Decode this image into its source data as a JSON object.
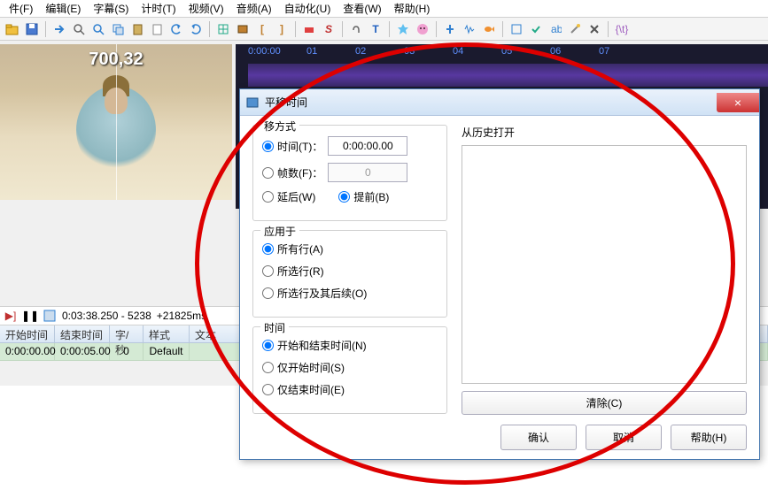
{
  "menu": [
    "件(F)",
    "编辑(E)",
    "字幕(S)",
    "计时(T)",
    "视频(V)",
    "音频(A)",
    "自动化(U)",
    "查看(W)",
    "帮助(H)"
  ],
  "video": {
    "timestamp": "700,32"
  },
  "ruler": [
    "0:00:00",
    "01",
    "02",
    "03",
    "04",
    "05",
    "06",
    "07"
  ],
  "playback": {
    "time": "0:03:38.250 - 5238",
    "offset": "+21825ms"
  },
  "grid": {
    "headers": [
      "开始时间",
      "结束时间",
      "字/秒",
      "样式",
      "文本"
    ],
    "row": [
      "0:00:00.00",
      "0:00:05.00",
      "0",
      "Default",
      ""
    ]
  },
  "dialog": {
    "title": "平移时间",
    "close": "×",
    "shift": {
      "title": "移方式",
      "time_label": "时间(T)：",
      "time_value": "0:00:00.00",
      "frames_label": "帧数(F)：",
      "frames_value": "0",
      "backward": "延后(W)",
      "forward": "提前(B)"
    },
    "apply": {
      "title": "应用于",
      "all": "所有行(A)",
      "selected": "所选行(R)",
      "onward": "所选行及其后续(O)"
    },
    "times": {
      "title": "时间",
      "both": "开始和结束时间(N)",
      "start": "仅开始时间(S)",
      "end": "仅结束时间(E)"
    },
    "history": {
      "title": "从历史打开",
      "clear": "清除(C)"
    },
    "buttons": {
      "ok": "确认",
      "cancel": "取消",
      "help": "帮助(H)"
    }
  }
}
